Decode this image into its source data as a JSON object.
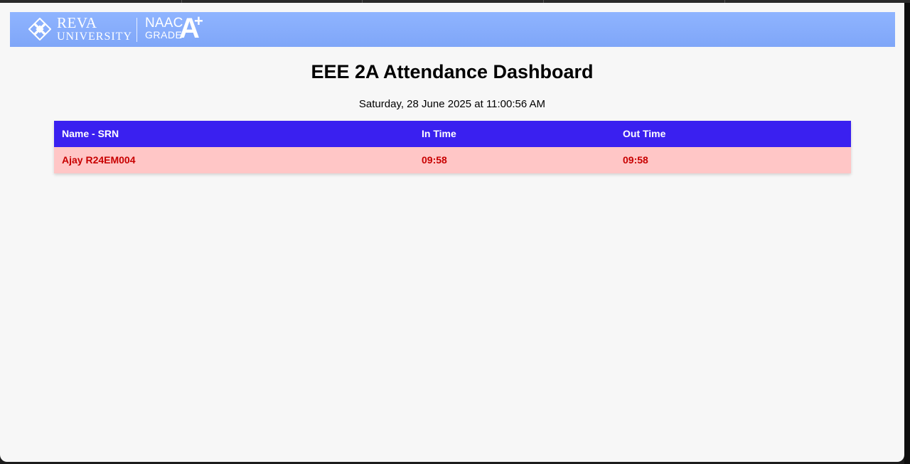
{
  "header": {
    "logo_line1": "REVA",
    "logo_line2": "UNIVERSITY",
    "naac_line1": "NAAC",
    "naac_line2": "GRADE",
    "grade_letter": "A",
    "grade_plus": "+",
    "accent_color": "#8fb4ff",
    "logo_icon": "reva-knot-icon"
  },
  "main": {
    "title": "EEE 2A Attendance Dashboard",
    "datetime": "Saturday, 28 June 2025 at 11:00:56 AM"
  },
  "table": {
    "header_color": "#3a20f0",
    "row_color": "#ffc6c6",
    "row_text_color": "#c80000",
    "columns": [
      "Name - SRN",
      "In Time",
      "Out Time"
    ],
    "rows": [
      [
        "Ajay R24EM004",
        "09:58",
        "09:58"
      ]
    ]
  }
}
